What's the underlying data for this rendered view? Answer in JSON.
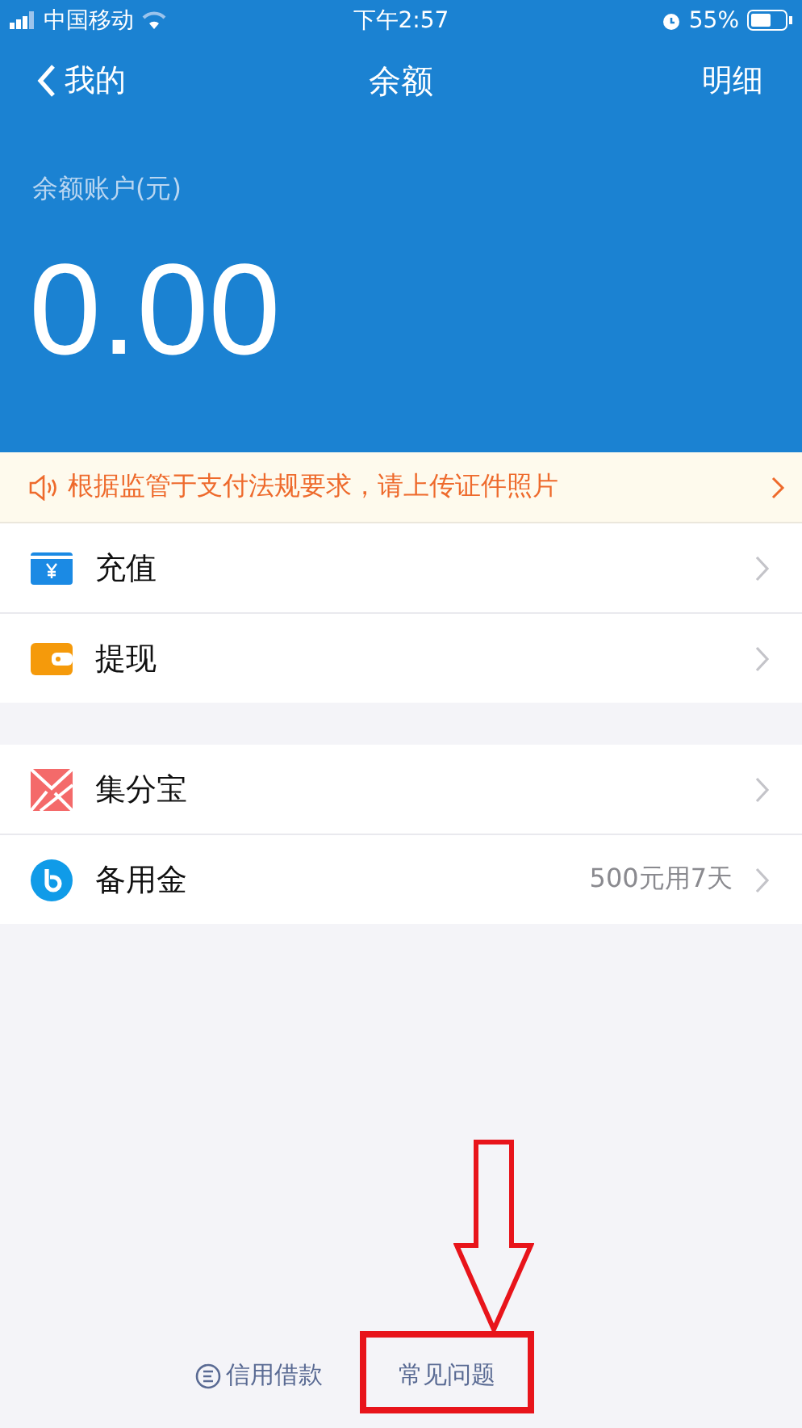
{
  "status_bar": {
    "carrier": "中国移动",
    "time": "下午2:57",
    "battery": "55%"
  },
  "nav": {
    "back": "我的",
    "title": "余额",
    "action": "明细"
  },
  "balance": {
    "label": "余额账户(元)",
    "amount": "0.00"
  },
  "notice": {
    "text": "根据监管于支付法规要求，请上传证件照片"
  },
  "sections": [
    [
      {
        "kind": "topup",
        "label": "充值"
      },
      {
        "kind": "withdraw",
        "label": "提现"
      }
    ],
    [
      {
        "kind": "points",
        "label": "集分宝"
      },
      {
        "kind": "reserve",
        "label": "备用金",
        "note": "500元用7天"
      }
    ]
  ],
  "footer_links": [
    {
      "kind": "loan",
      "label": "信用借款",
      "highlighted": false
    },
    {
      "kind": "faq",
      "label": "常见问题",
      "highlighted": true
    }
  ]
}
